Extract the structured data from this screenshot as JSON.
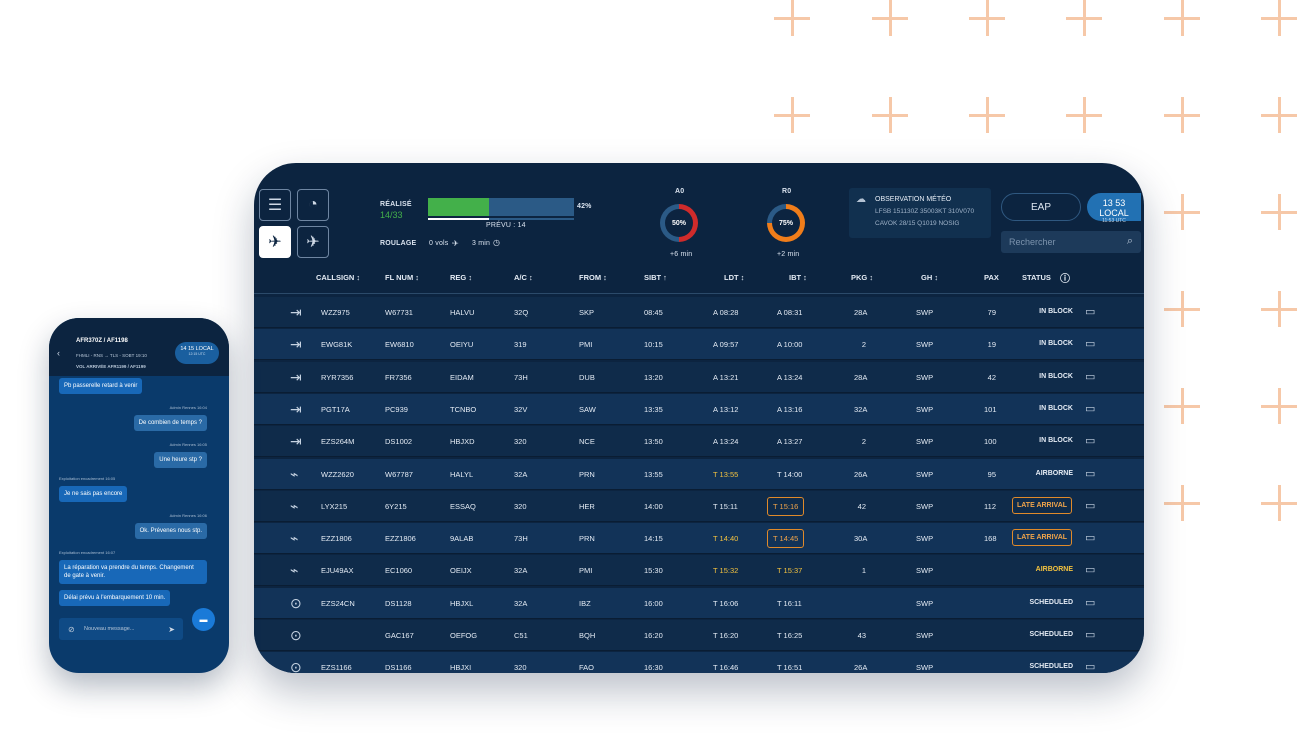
{
  "tablet": {
    "realise_label": "RÉALISÉ",
    "realise_value": "14/33",
    "progress_pct": "42%",
    "progress_fraction": 0.42,
    "prevu_label": "PRÉVU : 14",
    "roulage_label": "ROULAGE",
    "roulage_vols": "0 vols",
    "roulage_min": "3 min",
    "a0": {
      "label": "A0",
      "value": "50%",
      "fraction": 0.5,
      "delta": "+6 min",
      "color": "#cf2b2b"
    },
    "r0": {
      "label": "R0",
      "value": "75%",
      "fraction": 0.75,
      "delta": "+2 min",
      "color": "#f07d1a"
    },
    "meteo": {
      "title": "OBSERVATION MÉTÉO",
      "line1": "LFSB 151130Z 35003KT 310V070",
      "line2": "CAVOK 28/15 Q1019 NOSIG"
    },
    "eap": "EAP",
    "local_time": "13 53 LOCAL",
    "local_sub": "11:53 UTC",
    "search_placeholder": "Rechercher",
    "columns": [
      "CALLSIGN ↕",
      "FL NUM ↕",
      "REG ↕",
      "A/C ↕",
      "FROM ↕",
      "SIBT ↑",
      "LDT ↕",
      "IBT ↕",
      "PKG ↕",
      "GH ↕",
      "PAX",
      "STATUS"
    ],
    "rows": [
      {
        "icon": "landed",
        "callsign": "WZZ975",
        "fl": "W67731",
        "reg": "HALVU",
        "ac": "32Q",
        "from": "SKP",
        "sibt": "08:45",
        "ldt": "A 08:28",
        "ibt": "A 08:31",
        "pkg": "28A",
        "gh": "SWP",
        "pax": "79",
        "status": "IN BLOCK"
      },
      {
        "icon": "landed",
        "callsign": "EWG81K",
        "fl": "EW6810",
        "reg": "OEIYU",
        "ac": "319",
        "from": "PMI",
        "sibt": "10:15",
        "ldt": "A 09:57",
        "ibt": "A 10:00",
        "pkg": "2",
        "gh": "SWP",
        "pax": "19",
        "status": "IN BLOCK"
      },
      {
        "icon": "landed",
        "callsign": "RYR7356",
        "fl": "FR7356",
        "reg": "EIDAM",
        "ac": "73H",
        "from": "DUB",
        "sibt": "13:20",
        "ldt": "A 13:21",
        "ibt": "A 13:24",
        "pkg": "28A",
        "gh": "SWP",
        "pax": "42",
        "status": "IN BLOCK"
      },
      {
        "icon": "landed",
        "callsign": "PGT17A",
        "fl": "PC939",
        "reg": "TCNBO",
        "ac": "32V",
        "from": "SAW",
        "sibt": "13:35",
        "ldt": "A 13:12",
        "ibt": "A 13:16",
        "pkg": "32A",
        "gh": "SWP",
        "pax": "101",
        "status": "IN BLOCK"
      },
      {
        "icon": "landed",
        "callsign": "EZS264M",
        "fl": "DS1002",
        "reg": "HBJXD",
        "ac": "320",
        "from": "NCE",
        "sibt": "13:50",
        "ldt": "A 13:24",
        "ibt": "A 13:27",
        "pkg": "2",
        "gh": "SWP",
        "pax": "100",
        "status": "IN BLOCK"
      },
      {
        "icon": "landing",
        "callsign": "WZZ2620",
        "fl": "W67787",
        "reg": "HALYL",
        "ac": "32A",
        "from": "PRN",
        "sibt": "13:55",
        "ldt": "T 13:55",
        "ibt": "T 14:00",
        "pkg": "26A",
        "gh": "SWP",
        "pax": "95",
        "status": "AIRBORNE"
      },
      {
        "icon": "landing",
        "callsign": "LYX215",
        "fl": "6Y215",
        "reg": "ESSAQ",
        "ac": "320",
        "from": "HER",
        "sibt": "14:00",
        "ldt": "T 15:11",
        "ibt": "T 15:16",
        "pkg": "42",
        "gh": "SWP",
        "pax": "112",
        "status": "LATE ARRIVAL"
      },
      {
        "icon": "landing",
        "callsign": "EZZ1806",
        "fl": "EZZ1806",
        "reg": "9ALAB",
        "ac": "73H",
        "from": "PRN",
        "sibt": "14:15",
        "ldt": "T 14:40",
        "ibt": "T 14:45",
        "pkg": "30A",
        "gh": "SWP",
        "pax": "168",
        "status": "LATE ARRIVAL"
      },
      {
        "icon": "landing",
        "callsign": "EJU49AX",
        "fl": "EC1060",
        "reg": "OEIJX",
        "ac": "32A",
        "from": "PMI",
        "sibt": "15:30",
        "ldt": "T 15:32",
        "ibt": "T 15:37",
        "pkg": "1",
        "gh": "SWP",
        "pax": "",
        "status": "AIRBORNE"
      },
      {
        "icon": "scheduled",
        "callsign": "EZS24CN",
        "fl": "DS1128",
        "reg": "HBJXL",
        "ac": "32A",
        "from": "IBZ",
        "sibt": "16:00",
        "ldt": "T 16:06",
        "ibt": "T 16:11",
        "pkg": "",
        "gh": "SWP",
        "pax": "",
        "status": "SCHEDULED"
      },
      {
        "icon": "scheduled",
        "callsign": "",
        "fl": "GAC167",
        "reg": "OEFOG",
        "ac": "C51",
        "from": "BQH",
        "sibt": "16:20",
        "ldt": "T 16:20",
        "ibt": "T 16:25",
        "pkg": "43",
        "gh": "SWP",
        "pax": "",
        "status": "SCHEDULED"
      },
      {
        "icon": "scheduled",
        "callsign": "EZS1166",
        "fl": "DS1166",
        "reg": "HBJXI",
        "ac": "320",
        "from": "FAO",
        "sibt": "16:30",
        "ldt": "T 16:46",
        "ibt": "T 16:51",
        "pkg": "26A",
        "gh": "SWP",
        "pax": "",
        "status": "SCHEDULED"
      }
    ]
  },
  "phone": {
    "title": "AFR370Z / AF1198",
    "subtitle": "FHMLI - RNS → TLS - SOBT 19:10",
    "arrival": "VOL ARRIVÉE AFR1199 / AF1199",
    "local_time": "14 15 LOCAL",
    "local_sub": "12:15 UTC",
    "messages": [
      {
        "side": "left",
        "text": "Pb passerelle retard à venir",
        "meta": ""
      },
      {
        "side": "right",
        "text": "De combien de temps ?",
        "meta": "Admin Rennes 16:04"
      },
      {
        "side": "right",
        "text": "Une heure stp ?",
        "meta": "Admin Rennes 16:05"
      },
      {
        "side": "left",
        "text": "Je ne sais pas encore",
        "meta": "Exploitation encadrement 16:05"
      },
      {
        "side": "right",
        "text": "Ok. Prévenes nous stp.",
        "meta": "Admin Rennes 16:06"
      },
      {
        "side": "left",
        "text": "La réparation va prendre du temps. Changement de gate à venir.",
        "meta": "Exploitation encadrement 16:07"
      },
      {
        "side": "left",
        "text": "Délai prévu à l'embarquement 10 min.",
        "meta": ""
      }
    ],
    "input_placeholder": "Nouveau message..."
  }
}
